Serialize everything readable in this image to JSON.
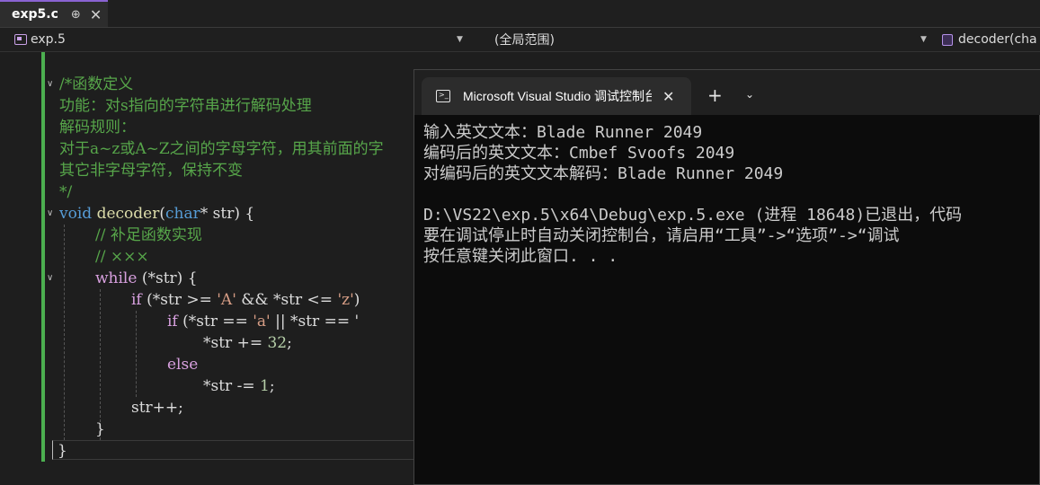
{
  "tab": {
    "label": "exp5.c",
    "pin": "⊕",
    "close": "✕"
  },
  "nav": {
    "project": "exp.5",
    "scope": "(全局范围)",
    "member": "decoder(cha"
  },
  "code": {
    "l1": "/*函数定义",
    "l2": "功能：对s指向的字符串进行解码处理",
    "l3": "解码规则：",
    "l4": "对于a~z或A~Z之间的字母字符，用其前面的字",
    "l5": "其它非字母字符，保持不变",
    "l6": "*/",
    "l7_kw": "void",
    "l7_fn": "decoder",
    "l7_rest_a": "(",
    "l7_type": "char",
    "l7_rest_b": "* str) {",
    "l8": "// 补足函数实现",
    "l9": "// ×××",
    "l10_kw": "while",
    "l10_rest": " (*str) {",
    "l11_kw": "if",
    "l11_a": " (*str >= ",
    "l11_s1": "'A'",
    "l11_b": " && *str <= ",
    "l11_s2": "'z'",
    "l11_c": ")",
    "l12_kw": "if",
    "l12_a": " (*str == ",
    "l12_s1": "'a'",
    "l12_b": " || *str == '",
    "l13_a": "*str += ",
    "l13_n": "32",
    "l13_b": ";",
    "l14_kw": "else",
    "l15_a": "*str -= ",
    "l15_n": "1",
    "l15_b": ";",
    "l16": "str++;",
    "l17": "}",
    "l18": "}"
  },
  "console": {
    "title": "Microsoft Visual Studio 调试控制台",
    "close": "✕",
    "plus": "+",
    "chevron": "⌄",
    "lines": [
      "输入英文文本：Blade Runner 2049",
      "编码后的英文文本：Cmbef Svoofs 2049",
      "对编码后的英文文本解码：Blade Runner 2049",
      "",
      "D:\\VS22\\exp.5\\x64\\Debug\\exp.5.exe (进程 18648)已退出，代码",
      "要在调试停止时自动关闭控制台，请启用“工具”->“选项”->“调试",
      "按任意键关闭此窗口. . ."
    ]
  }
}
